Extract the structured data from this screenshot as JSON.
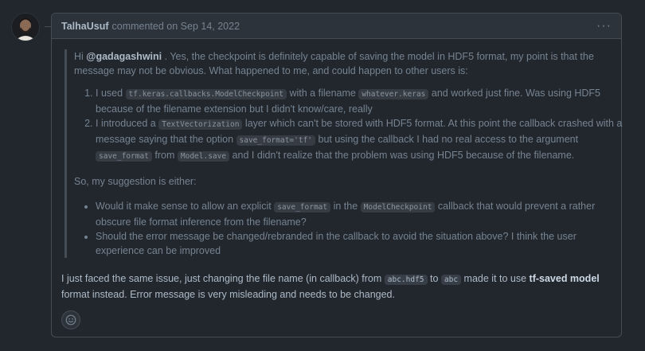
{
  "comment": {
    "author": "TalhaUsuf",
    "meta": "commented on Sep 14, 2022",
    "menu_icon": "kebab-horizontal-icon"
  },
  "quote": {
    "intro_prefix": "Hi ",
    "mention": "@gadagashwini",
    "intro_text": " . Yes, the checkpoint is definitely capable of saving the model in HDF5 format, my point is that the message may not be obvious. What happened to me, and could happen to other users is:",
    "item1": {
      "t1": "I used ",
      "c1": "tf.keras.callbacks.ModelCheckpoint",
      "t2": " with a filename ",
      "c2": "whatever.keras",
      "t3": " and worked just fine. Was using HDF5 because of the filename extension but I didn't know/care, really"
    },
    "item2": {
      "t1": "I introduced a ",
      "c1": "TextVectorization",
      "t2": " layer which can't be stored with HDF5 format. At this point the callback crashed with a message saying that the option ",
      "c2": "save_format='tf'",
      "t3": " but using the callback I had no real access to the argument ",
      "c3": "save_format",
      "t4": " from ",
      "c4": "Model.save",
      "t5": " and I didn't realize that the problem was using HDF5 because of the filename."
    },
    "suggestion": "So, my suggestion is either:",
    "bullet1": {
      "t1": "Would it make sense to allow an explicit ",
      "c1": "save_format",
      "t2": " in the ",
      "c2": "ModelCheckpoint",
      "t3": " callback that would prevent a rather obscure file format inference from the filename?"
    },
    "bullet2": "Should the error message be changed/rebranded in the callback to avoid the situation above? I think the user experience can be improved"
  },
  "reply": {
    "t1": "I just faced the same issue, just changing the file name (in callback) from ",
    "c1": "abc.hdf5",
    "t2": " to ",
    "c2": "abc",
    "t3": " made it to use ",
    "b1": "tf-saved model",
    "t4": " format instead. Error message is very misleading and needs to be changed."
  },
  "reaction_icon": "smiley-icon"
}
